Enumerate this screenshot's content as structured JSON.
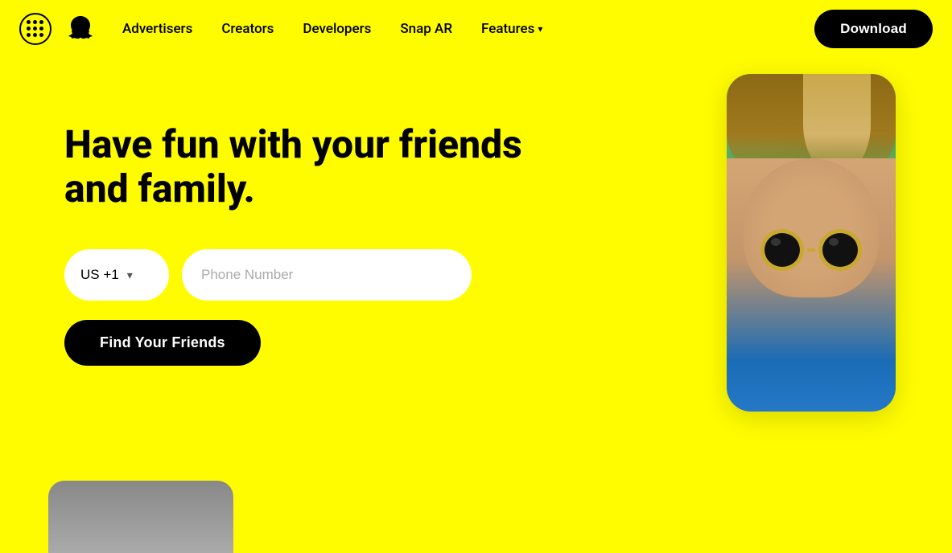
{
  "navbar": {
    "nav_links": [
      {
        "label": "Advertisers",
        "id": "advertisers"
      },
      {
        "label": "Creators",
        "id": "creators"
      },
      {
        "label": "Developers",
        "id": "developers"
      },
      {
        "label": "Snap AR",
        "id": "snap-ar"
      },
      {
        "label": "Features",
        "id": "features",
        "has_dropdown": true
      }
    ],
    "download_label": "Download"
  },
  "hero": {
    "title": "Have fun with your friends and family.",
    "country_code": "US +1",
    "phone_placeholder": "Phone Number",
    "find_friends_label": "Find Your Friends"
  },
  "decorative": {
    "stripes_color": "#FFFC00"
  }
}
